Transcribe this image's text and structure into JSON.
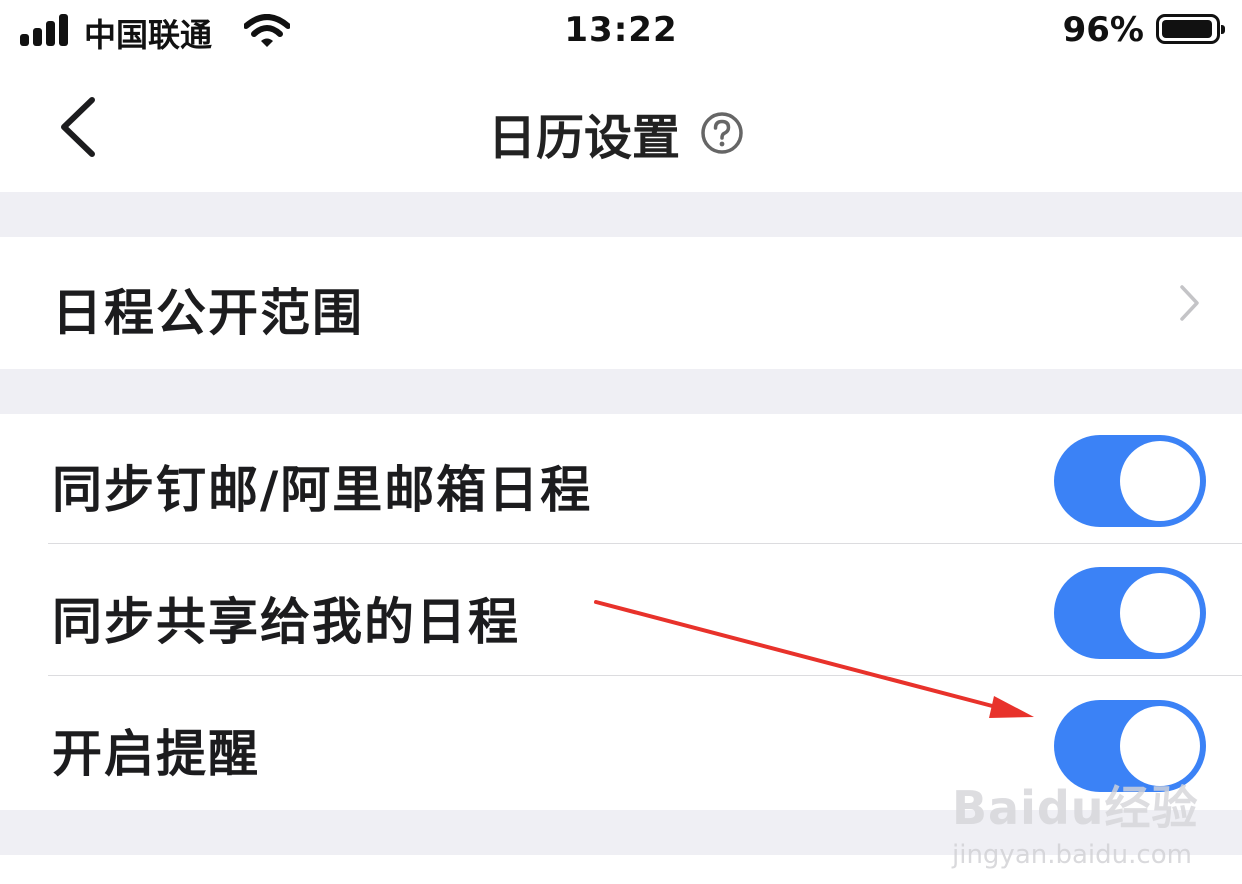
{
  "status_bar": {
    "carrier": "中国联通",
    "time": "13:22",
    "battery_percent": "96%",
    "battery_level": 0.96
  },
  "nav": {
    "title": "日历设置",
    "back_icon": "chevron-left-icon",
    "help_icon": "question-circle-icon"
  },
  "settings": {
    "schedule_visibility": {
      "label": "日程公开范围",
      "icon": "chevron-right-icon"
    },
    "toggles": [
      {
        "label": "同步钉邮/阿里邮箱日程",
        "on": true
      },
      {
        "label": "同步共享给我的日程",
        "on": true
      },
      {
        "label": "开启提醒",
        "on": true
      }
    ]
  },
  "colors": {
    "toggle_on": "#3b82f6",
    "section_gap": "#efeff4",
    "arrow": "#e8322b"
  },
  "watermark": {
    "logo": "Baidu经验",
    "url": "jingyan.baidu.com"
  }
}
